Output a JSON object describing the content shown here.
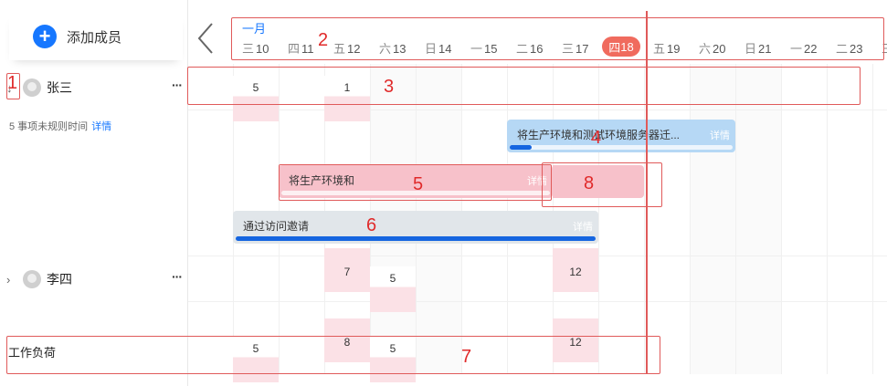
{
  "sidebar": {
    "add_member_label": "添加成员",
    "members": [
      {
        "name": "张三",
        "expanded": true
      },
      {
        "name": "李四",
        "expanded": false
      }
    ],
    "more_icon": "···",
    "unscheduled_text": "5 事项未规则时间",
    "unscheduled_link": "详情",
    "workload_label": "工作负荷"
  },
  "header": {
    "month": "一月",
    "days": [
      {
        "weekday": "三",
        "date": "10"
      },
      {
        "weekday": "四",
        "date": "11"
      },
      {
        "weekday": "五",
        "date": "12"
      },
      {
        "weekday": "六",
        "date": "13"
      },
      {
        "weekday": "日",
        "date": "14"
      },
      {
        "weekday": "一",
        "date": "15"
      },
      {
        "weekday": "二",
        "date": "16"
      },
      {
        "weekday": "三",
        "date": "17"
      },
      {
        "weekday": "四",
        "date": "18",
        "today": true
      },
      {
        "weekday": "五",
        "date": "19"
      },
      {
        "weekday": "六",
        "date": "20"
      },
      {
        "weekday": "日",
        "date": "21"
      },
      {
        "weekday": "一",
        "date": "22"
      },
      {
        "weekday": "二",
        "date": "23"
      },
      {
        "weekday": "三",
        "date": ""
      }
    ]
  },
  "zhangsan_load": [
    {
      "day": 0,
      "value": "5"
    },
    {
      "day": 2,
      "value": "1"
    }
  ],
  "tasks": [
    {
      "title": "将生产环境和测试环境服务器迁...",
      "detail": "详情",
      "progress": 0.1,
      "color": "#b6d8f5",
      "text_color": "#333"
    },
    {
      "title": "将生产环境和",
      "detail": "详情",
      "progress": 0,
      "color": "#f7c1ca",
      "text_color": "#333"
    },
    {
      "title": "通过访问邀请",
      "detail": "详情",
      "progress": 1.0,
      "color": "#e1e6ea",
      "text_color": "#333"
    }
  ],
  "lisi_load": [
    {
      "day": 2,
      "value": "7"
    },
    {
      "day": 3,
      "value": "5"
    },
    {
      "day": 7,
      "value": "12"
    }
  ],
  "workload": [
    {
      "day": 0,
      "value": "5"
    },
    {
      "day": 2,
      "value": "8"
    },
    {
      "day": 3,
      "value": "5"
    },
    {
      "day": 7,
      "value": "12"
    }
  ],
  "annotations": [
    "1",
    "2",
    "3",
    "4",
    "5",
    "6",
    "7",
    "8"
  ],
  "colors": {
    "accent": "#1677ff",
    "today": "#f06b5e",
    "annotation": "#e02a2a",
    "load_pink": "#fbe1e6"
  }
}
